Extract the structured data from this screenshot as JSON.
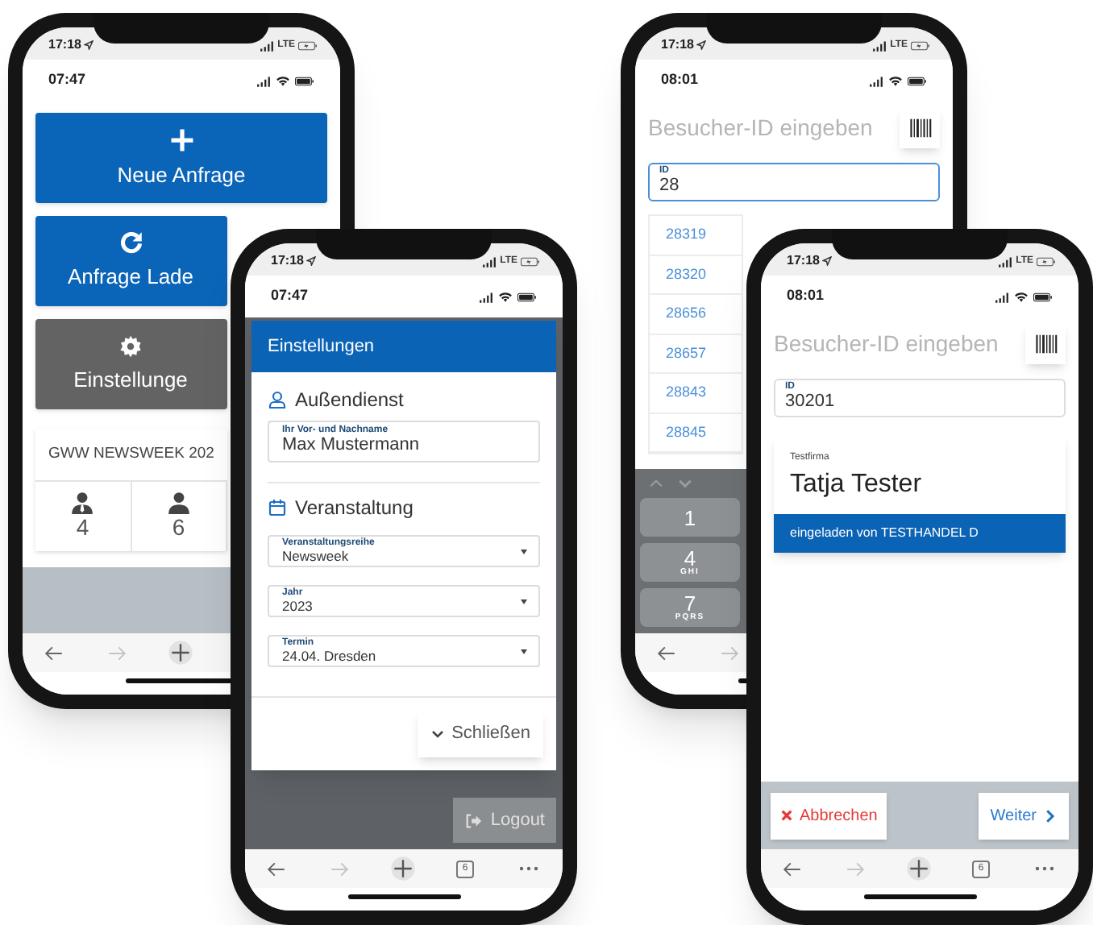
{
  "home_screen": {
    "device_status": {
      "time": "17:18",
      "network": "LTE"
    },
    "clock": "07:47",
    "actions": [
      {
        "kind": "new",
        "label": "Neue Anfrage"
      },
      {
        "kind": "load",
        "label": "Anfrage Lade"
      },
      {
        "kind": "settings",
        "label": "Einstellunge"
      }
    ],
    "event_card": {
      "title": "GWW NEWSWEEK 202",
      "stats": [
        {
          "kind": "staff",
          "value": "4"
        },
        {
          "kind": "visitor",
          "value": "6"
        }
      ]
    }
  },
  "settings_screen": {
    "device_status": {
      "time": "17:18",
      "network": "LTE"
    },
    "clock": "07:47",
    "dialog": {
      "title": "Einstellungen",
      "sections": [
        {
          "kind": "person",
          "title": "Außendienst",
          "fields": [
            {
              "kind": "text",
              "label": "Ihr Vor- und Nachname",
              "value": "Max Mustermann"
            }
          ]
        },
        {
          "kind": "event",
          "title": "Veranstaltung",
          "fields": [
            {
              "kind": "select",
              "label": "Veranstaltungsreihe",
              "value": "Newsweek"
            },
            {
              "kind": "select",
              "label": "Jahr",
              "value": "2023"
            },
            {
              "kind": "select",
              "label": "Termin",
              "value": "24.04. Dresden"
            }
          ]
        }
      ],
      "close_button": "Schließen"
    },
    "logout_button": "Logout",
    "browser": {
      "tab_count": "6"
    }
  },
  "id_search_screen": {
    "device_status": {
      "time": "17:18",
      "network": "LTE"
    },
    "clock": "08:01",
    "title": "Besucher-ID eingeben",
    "id_field": {
      "label": "ID",
      "value": "28",
      "focused": true
    },
    "suggestions": [
      "28319",
      "28320",
      "28656",
      "28657",
      "28843",
      "28845"
    ],
    "keypad": [
      {
        "digit": "1"
      },
      {
        "digit": "4",
        "letters": "GHI"
      },
      {
        "digit": "7",
        "letters": "PQRS"
      }
    ]
  },
  "visitor_screen": {
    "device_status": {
      "time": "17:18",
      "network": "LTE"
    },
    "clock": "08:01",
    "title": "Besucher-ID eingeben",
    "id_field": {
      "label": "ID",
      "value": "30201",
      "focused": false
    },
    "visitor": {
      "company": "Testfirma",
      "name": "Tatja Tester",
      "invited_by": "eingeladen von TESTHANDEL D"
    },
    "cancel_button": "Abbrechen",
    "next_button": "Weiter",
    "browser": {
      "tab_count": "6"
    }
  }
}
